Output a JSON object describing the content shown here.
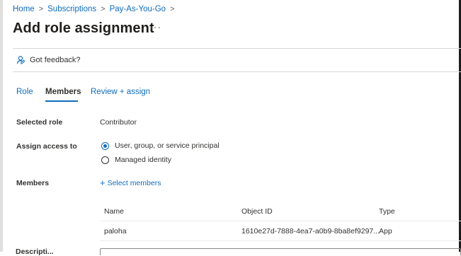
{
  "breadcrumb": {
    "items": [
      "Home",
      "Subscriptions",
      "Pay-As-You-Go"
    ],
    "separator": ">"
  },
  "page": {
    "title": "Add role assignment",
    "more": "···"
  },
  "toolbar": {
    "feedback_label": "Got feedback?"
  },
  "tabs": [
    {
      "label": "Role",
      "active": false
    },
    {
      "label": "Members",
      "active": true
    },
    {
      "label": "Review + assign",
      "active": false
    }
  ],
  "form": {
    "selected_role_label": "Selected role",
    "selected_role_value": "Contributor",
    "assign_access_label": "Assign access to",
    "assign_options": [
      {
        "label": "User, group, or service principal",
        "checked": true
      },
      {
        "label": "Managed identity",
        "checked": false
      }
    ],
    "members_label": "Members",
    "select_members_label": "Select members",
    "description_label": "Descripti..."
  },
  "members_table": {
    "columns": [
      "Name",
      "Object ID",
      "Type"
    ],
    "rows": [
      {
        "name": "paloha",
        "object_id": "1610e27d-7888-4ea7-a0b9-8ba8ef9297...",
        "type": "App"
      }
    ]
  },
  "colors": {
    "accent": "#0f6cbd",
    "text": "#323130"
  }
}
